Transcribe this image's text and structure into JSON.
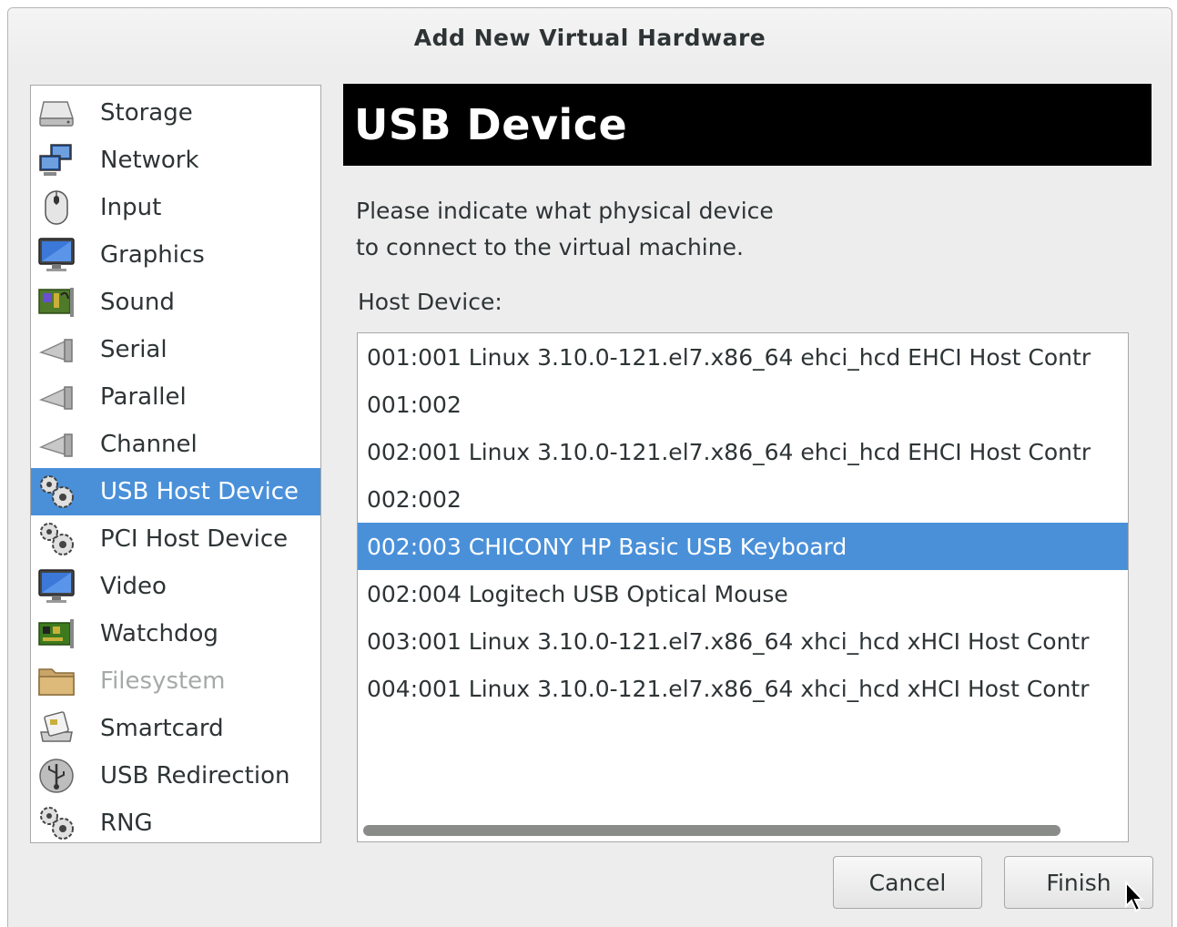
{
  "window": {
    "title": "Add New Virtual Hardware"
  },
  "hardware_list": {
    "items": [
      {
        "label": "Storage",
        "icon": "storage-icon",
        "state": "normal"
      },
      {
        "label": "Network",
        "icon": "network-icon",
        "state": "normal"
      },
      {
        "label": "Input",
        "icon": "mouse-icon",
        "state": "normal"
      },
      {
        "label": "Graphics",
        "icon": "monitor-icon",
        "state": "normal"
      },
      {
        "label": "Sound",
        "icon": "sound-card-icon",
        "state": "normal"
      },
      {
        "label": "Serial",
        "icon": "port-icon",
        "state": "normal"
      },
      {
        "label": "Parallel",
        "icon": "port-icon",
        "state": "normal"
      },
      {
        "label": "Channel",
        "icon": "port-icon",
        "state": "normal"
      },
      {
        "label": "USB Host Device",
        "icon": "gears-icon",
        "state": "selected"
      },
      {
        "label": "PCI Host Device",
        "icon": "gears-icon",
        "state": "normal"
      },
      {
        "label": "Video",
        "icon": "monitor-icon",
        "state": "normal"
      },
      {
        "label": "Watchdog",
        "icon": "circuit-board-icon",
        "state": "normal"
      },
      {
        "label": "Filesystem",
        "icon": "folder-icon",
        "state": "disabled"
      },
      {
        "label": "Smartcard",
        "icon": "smartcard-reader-icon",
        "state": "normal"
      },
      {
        "label": "USB Redirection",
        "icon": "usb-icon",
        "state": "normal"
      },
      {
        "label": "RNG",
        "icon": "gears-icon",
        "state": "normal"
      }
    ]
  },
  "panel": {
    "header": "USB Device",
    "description_line1": "Please indicate what physical device",
    "description_line2": "to connect to the virtual machine.",
    "host_device_label": "Host Device:",
    "devices": [
      {
        "text": "001:001 Linux 3.10.0-121.el7.x86_64 ehci_hcd EHCI Host Contr",
        "selected": false
      },
      {
        "text": "001:002",
        "selected": false
      },
      {
        "text": "002:001 Linux 3.10.0-121.el7.x86_64 ehci_hcd EHCI Host Contr",
        "selected": false
      },
      {
        "text": "002:002",
        "selected": false
      },
      {
        "text": "002:003 CHICONY HP Basic USB Keyboard",
        "selected": true
      },
      {
        "text": "002:004 Logitech USB Optical Mouse",
        "selected": false
      },
      {
        "text": "003:001 Linux 3.10.0-121.el7.x86_64 xhci_hcd xHCI Host Contr",
        "selected": false
      },
      {
        "text": "004:001 Linux 3.10.0-121.el7.x86_64 xhci_hcd xHCI Host Contr",
        "selected": false
      }
    ]
  },
  "buttons": {
    "cancel": "Cancel",
    "finish": "Finish"
  },
  "colors": {
    "selection": "#4a90d9",
    "header_bg": "#000000",
    "window_bg": "#ededed"
  }
}
